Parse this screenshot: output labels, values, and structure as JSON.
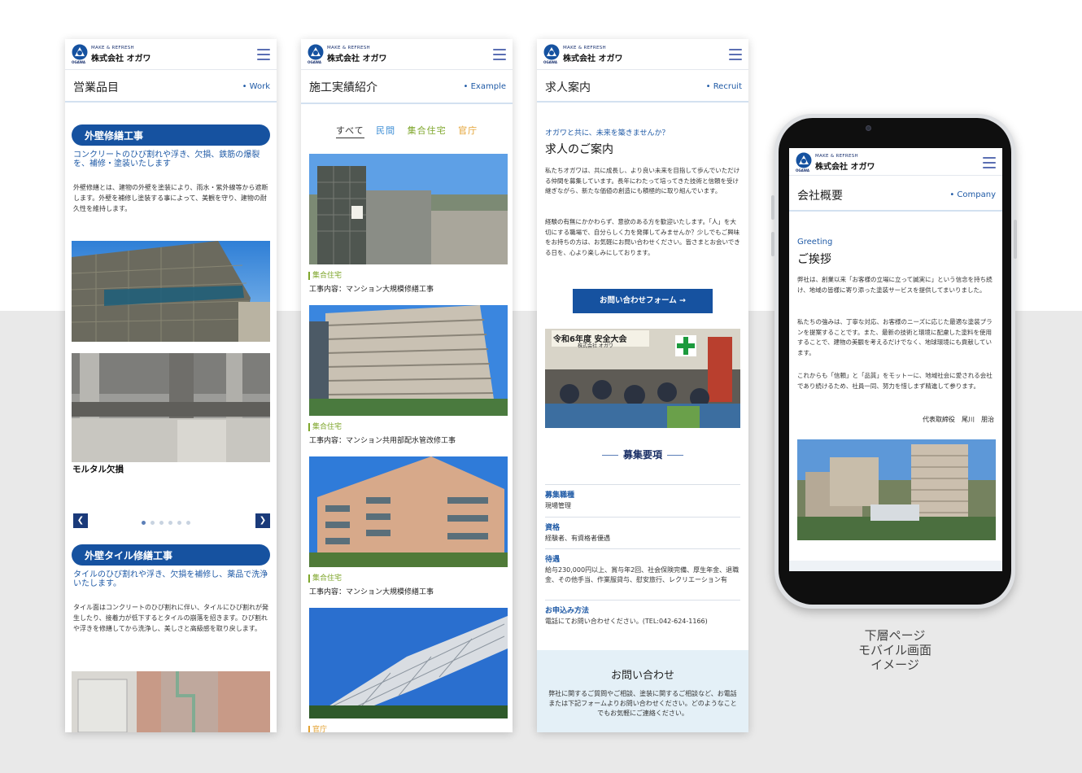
{
  "brand": {
    "tagline": "MAKE & REFRESH",
    "name": "株式会社 オガワ",
    "mark_text": "OGAWA",
    "color": "#1652a0"
  },
  "work_page": {
    "title": "営業品目",
    "title_en": "Work",
    "section1": {
      "heading": "外壁修繕工事",
      "sub": "コンクリートのひび割れや浮き、欠損、鉄筋の爆裂を、補修・塗装いたします",
      "body": "外壁修繕とは、建物の外壁を塗装により、雨水・紫外線等から遮断します。外壁を補修し塗装する事によって、美観を守り、建物の耐久性を維持します。",
      "slide_caption": "モルタル欠損",
      "prev_icon": "chevron-left-icon",
      "next_icon": "chevron-right-icon",
      "active_slide": 0
    },
    "section2": {
      "heading": "外壁タイル修繕工事",
      "sub": "タイルのひび割れや浮き、欠損を補修し、薬品で洗浄いたします。",
      "body": "タイル面はコンクリートのひび割れに伴い、タイルにひび割れが発生したり、接着力が低下するとタイルの崩落を招きます。ひび割れや浮きを修繕してから洗浄し、美しさと高級感を取り戻します。"
    }
  },
  "example_page": {
    "title": "施工実績紹介",
    "title_en": "Example",
    "filters": [
      "すべて",
      "民間",
      "集合住宅",
      "官庁"
    ],
    "items": [
      {
        "tag": "集合住宅",
        "work": "工事内容：マンション大規模修繕工事"
      },
      {
        "tag": "集合住宅",
        "work": "工事内容：マンション共用部配水管改修工事"
      },
      {
        "tag": "集合住宅",
        "work": "工事内容：マンション大規模修繕工事"
      },
      {
        "tag": "官庁",
        "work": ""
      }
    ]
  },
  "recruit_page": {
    "title": "求人案内",
    "title_en": "Recruit",
    "lead": "オガワと共に、未来を築きませんか？",
    "heading": "求人のご案内",
    "para1": "私たちオガワは、共に成長し、より良い未来を目指して歩んでいただける仲間を募集しています。長年にわたって培ってきた技術と信頼を受け継ぎながら、新たな価値の創造にも積極的に取り組んでいます。",
    "para2": "経験の有無にかかわらず、意欲のある方を歓迎いたします。「人」を大切にする職場で、自分らしく力を発揮してみませんか？少しでもご興味をお持ちの方は、お気軽にお問い合わせください。皆さまとお会いできる日を、心より楽しみにしております。",
    "cta": "お問い合わせフォーム →",
    "banner": "令和6年度 安全大会",
    "banner_sub": "株式会社 オガワ",
    "requirements_title": "募集要項",
    "requirements": [
      {
        "label": "募集職種",
        "value": "現場管理"
      },
      {
        "label": "資格",
        "value": "経験者、有資格者優遇"
      },
      {
        "label": "待遇",
        "value": "給与230,000円以上、賞与年2回、社会保険完備、厚生年金、退職金、その他手当、作業服貸与、慰安旅行、レクリエーション有"
      },
      {
        "label": "お申込み方法",
        "value": "電話にてお問い合わせください。(TEL:042-624-1166)"
      }
    ],
    "contact_title": "お問い合わせ",
    "contact_body": "弊社に関するご質問やご相談、塗装に関するご相談など、お電話または下記フォームよりお問い合わせください。どのようなことでもお気軽にご連絡ください。"
  },
  "company_page": {
    "title": "会社概要",
    "title_en": "Company",
    "greeting_en": "Greeting",
    "greeting": "ご挨拶",
    "para1": "弊社は、創業以来「お客様の立場に立って誠実に」という信念を持ち続け、地域の皆様に寄り添った塗装サービスを提供してまいりました。",
    "para2": "私たちの強みは、丁寧な対応、お客様のニーズに応じた最適な塗装プランを提案することです。また、最新の技術と環境に配慮した塗料を使用することで、建物の美観を考えるだけでなく、地球環境にも貢献しています。",
    "para3": "これからも「信頼」と「品質」をモットーに、地域社会に愛される会社であり続けるため、社員一同、努力を惜しまず精進して参ります。",
    "signature": "代表取締役　尾川　朋治"
  },
  "caption": {
    "line1": "下層ページ",
    "line2": "モバイル画面",
    "line3": "イメージ"
  }
}
